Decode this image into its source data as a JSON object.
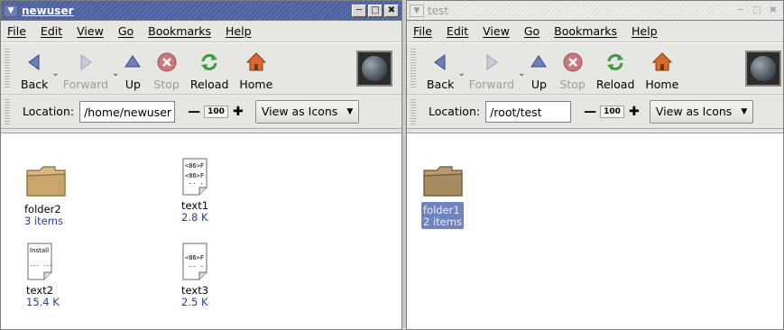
{
  "left_window": {
    "title": "newuser",
    "menu": [
      "File",
      "Edit",
      "View",
      "Go",
      "Bookmarks",
      "Help"
    ],
    "toolbar": {
      "back": "Back",
      "forward": "Forward",
      "up": "Up",
      "stop": "Stop",
      "reload": "Reload",
      "home": "Home"
    },
    "location_label": "Location:",
    "location_value": "/home/newuser",
    "zoom": "100",
    "view_as": "View as Icons",
    "items": [
      {
        "name": "folder2",
        "info": "3 items",
        "type": "folder"
      },
      {
        "name": "text1",
        "info": "2.8 K",
        "type": "text",
        "preview": [
          "<86>F",
          "<86>F",
          "-- -"
        ]
      },
      {
        "name": "text2",
        "info": "15.4 K",
        "type": "text",
        "preview": [
          "Install",
          "",
          "--- ---"
        ]
      },
      {
        "name": "text3",
        "info": "2.5 K",
        "type": "text",
        "preview": [
          "<86>F",
          "-- -"
        ]
      }
    ]
  },
  "right_window": {
    "title": "test",
    "menu": [
      "File",
      "Edit",
      "View",
      "Go",
      "Bookmarks",
      "Help"
    ],
    "toolbar": {
      "back": "Back",
      "forward": "Forward",
      "up": "Up",
      "stop": "Stop",
      "reload": "Reload",
      "home": "Home"
    },
    "location_label": "Location:",
    "location_value": "/root/test",
    "zoom": "100",
    "view_as": "View as Icons",
    "items": [
      {
        "name": "folder1",
        "info": "2 items",
        "type": "folder",
        "selected": true
      }
    ]
  },
  "colors": {
    "active_title": "#4a5d9e",
    "selection": "#6f84bf",
    "info_text": "#2a3f90"
  }
}
